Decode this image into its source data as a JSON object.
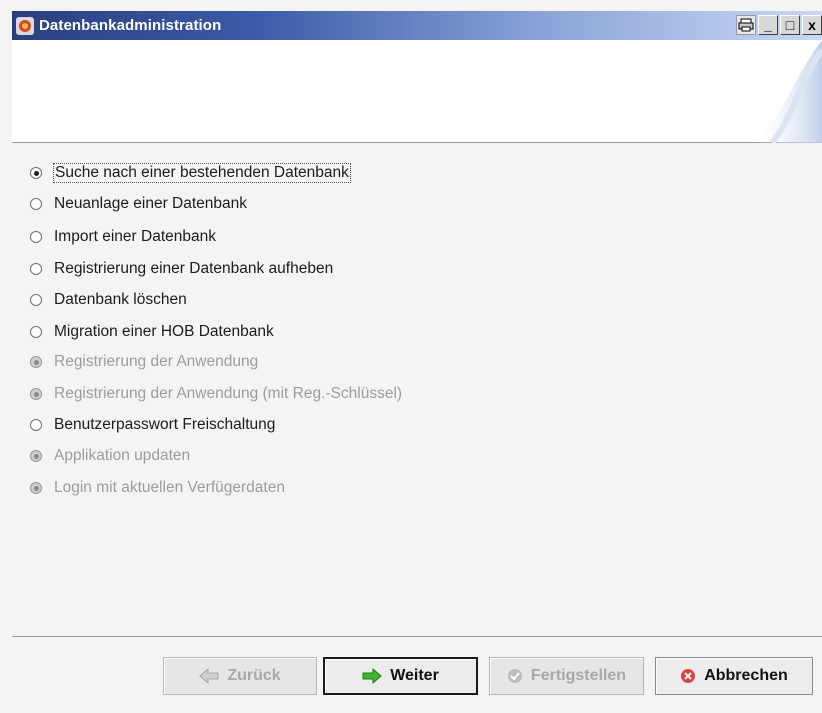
{
  "window": {
    "title": "Datenbankadministration",
    "controls": {
      "minimize": "_",
      "maximize": "□",
      "close": "x"
    }
  },
  "options": [
    {
      "label": "Suche nach einer bestehenden Datenbank",
      "selected": true,
      "enabled": true
    },
    {
      "label": "Neuanlage einer Datenbank",
      "selected": false,
      "enabled": true
    },
    {
      "label": "Import einer Datenbank",
      "selected": false,
      "enabled": true
    },
    {
      "label": "Registrierung einer Datenbank aufheben",
      "selected": false,
      "enabled": true
    },
    {
      "label": "Datenbank löschen",
      "selected": false,
      "enabled": true
    },
    {
      "label": "Migration einer HOB Datenbank",
      "selected": false,
      "enabled": true
    },
    {
      "label": "Registrierung der Anwendung",
      "selected": false,
      "enabled": false
    },
    {
      "label": "Registrierung der Anwendung (mit Reg.-Schlüssel)",
      "selected": false,
      "enabled": false
    },
    {
      "label": "Benutzerpasswort Freischaltung",
      "selected": false,
      "enabled": true
    },
    {
      "label": "Applikation updaten",
      "selected": false,
      "enabled": false
    },
    {
      "label": "Login mit aktuellen Verfügerdaten",
      "selected": false,
      "enabled": false
    }
  ],
  "buttons": {
    "back": {
      "label": "Zurück",
      "enabled": false
    },
    "next": {
      "label": "Weiter",
      "enabled": true
    },
    "finish": {
      "label": "Fertigstellen",
      "enabled": false
    },
    "cancel": {
      "label": "Abbrechen",
      "enabled": true
    }
  },
  "colors": {
    "title_bar": "#2a3f80",
    "next_arrow": "#3cb828",
    "cancel_icon": "#e04040",
    "disabled_text": "#9c9c9c"
  }
}
